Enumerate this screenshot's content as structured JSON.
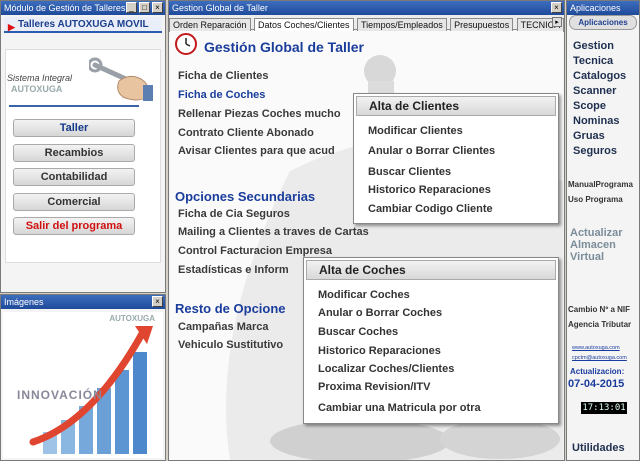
{
  "windows": {
    "left_title": "Módulo de Gestión de Talleres",
    "images_title": "Imágenes",
    "main_title": "Gestion Global de Taller",
    "apps_title": "Aplicaciones"
  },
  "left": {
    "banner": "Talleres AUTOXUGA MOVIL",
    "system_line1": "Sistema Integral",
    "system_line2": "AUTOXUGA",
    "nav": [
      "Taller",
      "Recambios",
      "Contabilidad",
      "Comercial",
      "Salir del programa"
    ]
  },
  "images": {
    "logo": "AUTOXUGA",
    "caption": "INNOVACIÓN"
  },
  "tabs": [
    "Orden Reparación",
    "Datos Coches/Clientes",
    "Tiempos/Empleados",
    "Presupuestos",
    "TECNICA"
  ],
  "main": {
    "title": "Gestión Global de Taller",
    "items1": [
      "Ficha de Clientes",
      "Ficha de Coches",
      "Rellenar Piezas Coches mucho",
      "Contrato Cliente Abonado",
      "Avisar Clientes para que acud"
    ],
    "section2": "Opciones Secundarias",
    "items2": [
      "Ficha de Cia Seguros",
      "Mailing a Clientes  a traves de Cartas",
      "Control Facturacion Empresa",
      "Estadísticas e Inform"
    ],
    "section3": "Resto de Opcione",
    "items3": [
      "Campañas Marca",
      "Vehiculo Sustitutivo"
    ]
  },
  "popup_clientes": {
    "header": "Alta de Clientes",
    "items": [
      "Modificar Clientes",
      "Anular o Borrar Clientes",
      "Buscar Clientes",
      "Historico Reparaciones",
      "Cambiar Codigo Cliente"
    ]
  },
  "popup_coches": {
    "header": "Alta de Coches",
    "items": [
      "Modificar Coches",
      "Anular o Borrar Coches",
      "Buscar Coches",
      "Historico Reparaciones",
      "Localizar Coches/Clientes",
      "Proxima Revision/ITV",
      "Cambiar una Matricula por otra"
    ]
  },
  "apps": {
    "button": "Aplicaciones",
    "links": [
      "Gestion",
      "Tecnica",
      "Catalogos",
      "Scanner",
      "Scope",
      "Nominas",
      "Gruas",
      "Seguros"
    ],
    "manual1": "ManualPrograma",
    "manual2": "Uso Programa",
    "update_lines": [
      "Actualizar",
      "Almacen",
      "Virtual"
    ],
    "nif": "Cambio Nº a NIF",
    "agencia": "Agencia Tributar",
    "url1": "www.autoxuga.com",
    "url2": "cpctm@autoxuga.com",
    "actualizacion_label": "Actualizacion:",
    "actualizacion_date": "07-04-2015",
    "clock": "17:13:01",
    "utilidades": "Utilidades"
  }
}
